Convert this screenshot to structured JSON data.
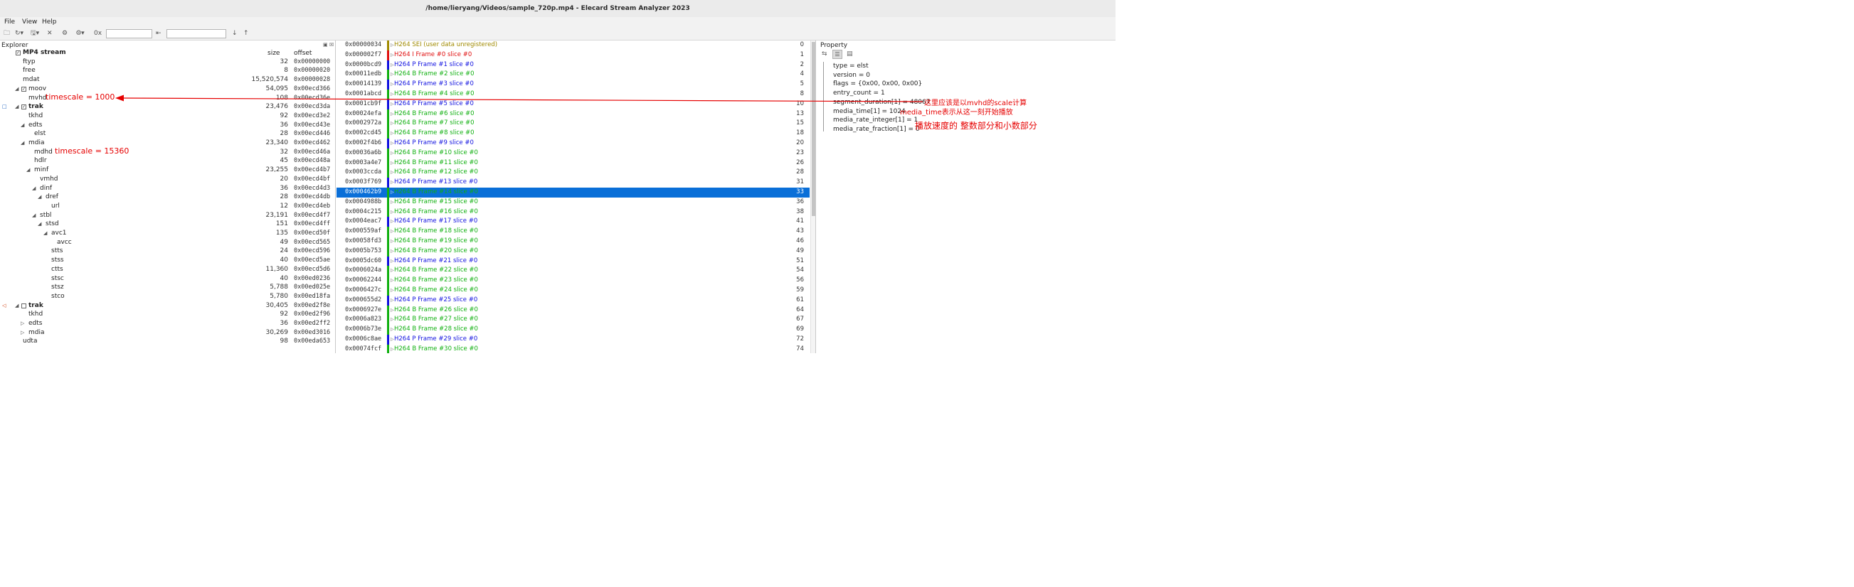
{
  "window": {
    "title": "/home/lieryang/Videos/sample_720p.mp4 - Elecard Stream Analyzer 2023"
  },
  "menu": [
    "File",
    "View",
    "Help"
  ],
  "toolbar": {
    "icons": [
      "open-icon",
      "refresh-icon",
      "save-icon",
      "close-icon",
      "settings-icon",
      "filter-icon",
      "hex-icon",
      "goto-icon",
      "arrow-down-icon",
      "arrow-up-icon"
    ],
    "search_value": "",
    "goto_value": ""
  },
  "explorer": {
    "title": "Explorer",
    "col_size": "size",
    "col_offset": "offset",
    "rows": [
      {
        "name": "MP4 stream",
        "size": "",
        "offset": "",
        "bold": true,
        "indent": 1,
        "cb": "checked"
      },
      {
        "name": "ftyp",
        "size": "32",
        "offset": "0x00000000",
        "indent": 2
      },
      {
        "name": "free",
        "size": "8",
        "offset": "0x00000020",
        "indent": 2
      },
      {
        "name": "mdat",
        "size": "15,520,574",
        "offset": "0x00000028",
        "indent": 2
      },
      {
        "name": "moov",
        "size": "54,095",
        "offset": "0x00ecd366",
        "indent": 2,
        "exp": "down",
        "cb": "checked"
      },
      {
        "name": "mvhd",
        "size": "108",
        "offset": "0x00ecd36e",
        "indent": 3
      },
      {
        "name": "trak",
        "size": "23,476",
        "offset": "0x00ecd3da",
        "bold": true,
        "indent": 2,
        "exp": "down",
        "cb": "checked",
        "marker": "video"
      },
      {
        "name": "tkhd",
        "size": "92",
        "offset": "0x00ecd3e2",
        "indent": 3
      },
      {
        "name": "edts",
        "size": "36",
        "offset": "0x00ecd43e",
        "indent": 3,
        "exp": "down"
      },
      {
        "name": "elst",
        "size": "28",
        "offset": "0x00ecd446",
        "indent": 4
      },
      {
        "name": "mdia",
        "size": "23,340",
        "offset": "0x00ecd462",
        "indent": 3,
        "exp": "down"
      },
      {
        "name": "mdhd",
        "size": "32",
        "offset": "0x00ecd46a",
        "indent": 4
      },
      {
        "name": "hdlr",
        "size": "45",
        "offset": "0x00ecd48a",
        "indent": 4
      },
      {
        "name": "minf",
        "size": "23,255",
        "offset": "0x00ecd4b7",
        "indent": 4,
        "exp": "down"
      },
      {
        "name": "vmhd",
        "size": "20",
        "offset": "0x00ecd4bf",
        "indent": 5
      },
      {
        "name": "dinf",
        "size": "36",
        "offset": "0x00ecd4d3",
        "indent": 5,
        "exp": "down"
      },
      {
        "name": "dref",
        "size": "28",
        "offset": "0x00ecd4db",
        "indent": 6,
        "exp": "down"
      },
      {
        "name": "url",
        "size": "12",
        "offset": "0x00ecd4eb",
        "indent": 7
      },
      {
        "name": "stbl",
        "size": "23,191",
        "offset": "0x00ecd4f7",
        "indent": 5,
        "exp": "down"
      },
      {
        "name": "stsd",
        "size": "151",
        "offset": "0x00ecd4ff",
        "indent": 6,
        "exp": "down"
      },
      {
        "name": "avc1",
        "size": "135",
        "offset": "0x00ecd50f",
        "indent": 7,
        "exp": "down"
      },
      {
        "name": "avcc",
        "size": "49",
        "offset": "0x00ecd565",
        "indent": 8
      },
      {
        "name": "stts",
        "size": "24",
        "offset": "0x00ecd596",
        "indent": 7
      },
      {
        "name": "stss",
        "size": "40",
        "offset": "0x00ecd5ae",
        "indent": 7
      },
      {
        "name": "ctts",
        "size": "11,360",
        "offset": "0x00ecd5d6",
        "indent": 7
      },
      {
        "name": "stsc",
        "size": "40",
        "offset": "0x00ed0236",
        "indent": 7
      },
      {
        "name": "stsz",
        "size": "5,788",
        "offset": "0x00ed025e",
        "indent": 7
      },
      {
        "name": "stco",
        "size": "5,780",
        "offset": "0x00ed18fa",
        "indent": 7
      },
      {
        "name": "trak",
        "size": "30,405",
        "offset": "0x00ed2f8e",
        "bold": true,
        "indent": 2,
        "exp": "down",
        "cb": "empty",
        "marker": "audio"
      },
      {
        "name": "tkhd",
        "size": "92",
        "offset": "0x00ed2f96",
        "indent": 3
      },
      {
        "name": "edts",
        "size": "36",
        "offset": "0x00ed2ff2",
        "indent": 3,
        "exp": "right"
      },
      {
        "name": "mdia",
        "size": "30,269",
        "offset": "0x00ed3016",
        "indent": 3,
        "exp": "right"
      },
      {
        "name": "udta",
        "size": "98",
        "offset": "0x00eda653",
        "indent": 2
      }
    ]
  },
  "annotations": {
    "mvhd_note": "timescale = 1000",
    "mdhd_note": "timescale = 15360",
    "segment_note": "这里应该是以mvhd的scale计算",
    "media_time_note": "media_time表示从这一刻开始播放",
    "rate_note": "播放速度的 整数部分和小数部分"
  },
  "frames": {
    "selected_index": 15,
    "rows": [
      {
        "offset": "0x00000034",
        "label": "H264 SEI (user data unregistered)",
        "num": "0",
        "kind": "SEI"
      },
      {
        "offset": "0x000002f7",
        "label": "H264 I Frame #0 slice #0",
        "num": "1",
        "kind": "I"
      },
      {
        "offset": "0x0000bcd9",
        "label": "H264 P Frame #1 slice #0",
        "num": "2",
        "kind": "P"
      },
      {
        "offset": "0x00011edb",
        "label": "H264 B Frame #2 slice #0",
        "num": "4",
        "kind": "B"
      },
      {
        "offset": "0x00014139",
        "label": "H264 P Frame #3 slice #0",
        "num": "5",
        "kind": "P"
      },
      {
        "offset": "0x0001abcd",
        "label": "H264 B Frame #4 slice #0",
        "num": "8",
        "kind": "B"
      },
      {
        "offset": "0x0001cb9f",
        "label": "H264 P Frame #5 slice #0",
        "num": "10",
        "kind": "P"
      },
      {
        "offset": "0x00024efa",
        "label": "H264 B Frame #6 slice #0",
        "num": "13",
        "kind": "B"
      },
      {
        "offset": "0x0002972a",
        "label": "H264 B Frame #7 slice #0",
        "num": "15",
        "kind": "B"
      },
      {
        "offset": "0x0002cd45",
        "label": "H264 B Frame #8 slice #0",
        "num": "18",
        "kind": "B"
      },
      {
        "offset": "0x0002f4b6",
        "label": "H264 P Frame #9 slice #0",
        "num": "20",
        "kind": "P"
      },
      {
        "offset": "0x00036a6b",
        "label": "H264 B Frame #10 slice #0",
        "num": "23",
        "kind": "B"
      },
      {
        "offset": "0x0003a4e7",
        "label": "H264 B Frame #11 slice #0",
        "num": "26",
        "kind": "B"
      },
      {
        "offset": "0x0003ccda",
        "label": "H264 B Frame #12 slice #0",
        "num": "28",
        "kind": "B"
      },
      {
        "offset": "0x0003f769",
        "label": "H264 P Frame #13 slice #0",
        "num": "31",
        "kind": "P"
      },
      {
        "offset": "0x000462b9",
        "label": "H264 B Frame #14 slice #0",
        "num": "33",
        "kind": "B"
      },
      {
        "offset": "0x0004988b",
        "label": "H264 B Frame #15 slice #0",
        "num": "36",
        "kind": "B"
      },
      {
        "offset": "0x0004c215",
        "label": "H264 B Frame #16 slice #0",
        "num": "38",
        "kind": "B"
      },
      {
        "offset": "0x0004eac7",
        "label": "H264 P Frame #17 slice #0",
        "num": "41",
        "kind": "P"
      },
      {
        "offset": "0x000559af",
        "label": "H264 B Frame #18 slice #0",
        "num": "43",
        "kind": "B"
      },
      {
        "offset": "0x00058fd3",
        "label": "H264 B Frame #19 slice #0",
        "num": "46",
        "kind": "B"
      },
      {
        "offset": "0x0005b753",
        "label": "H264 B Frame #20 slice #0",
        "num": "49",
        "kind": "B"
      },
      {
        "offset": "0x0005dc60",
        "label": "H264 P Frame #21 slice #0",
        "num": "51",
        "kind": "P"
      },
      {
        "offset": "0x0006024a",
        "label": "H264 B Frame #22 slice #0",
        "num": "54",
        "kind": "B"
      },
      {
        "offset": "0x00062244",
        "label": "H264 B Frame #23 slice #0",
        "num": "56",
        "kind": "B"
      },
      {
        "offset": "0x0006427c",
        "label": "H264 B Frame #24 slice #0",
        "num": "59",
        "kind": "B"
      },
      {
        "offset": "0x000655d2",
        "label": "H264 P Frame #25 slice #0",
        "num": "61",
        "kind": "P"
      },
      {
        "offset": "0x0006927e",
        "label": "H264 B Frame #26 slice #0",
        "num": "64",
        "kind": "B"
      },
      {
        "offset": "0x0006a823",
        "label": "H264 B Frame #27 slice #0",
        "num": "67",
        "kind": "B"
      },
      {
        "offset": "0x0006b73e",
        "label": "H264 B Frame #28 slice #0",
        "num": "69",
        "kind": "B"
      },
      {
        "offset": "0x0006c8ae",
        "label": "H264 P Frame #29 slice #0",
        "num": "72",
        "kind": "P"
      },
      {
        "offset": "0x00074fcf",
        "label": "H264 B Frame #30 slice #0",
        "num": "74",
        "kind": "B"
      }
    ]
  },
  "property": {
    "title": "Property",
    "rows": [
      "type = elst",
      "version = 0",
      "flags = {0x00, 0x00, 0x00}",
      "entry_count = 1",
      "segment_duration[1] = 48067",
      "media_time[1] = 1024",
      "media_rate_integer[1] = 1",
      "media_rate_fraction[1] = 0"
    ]
  },
  "colors": {
    "I": "#e01010",
    "P": "#1010e0",
    "B": "#10b010",
    "SEI": "#a08a00",
    "selection": "#0a6fd8",
    "annotation": "#e60000"
  }
}
